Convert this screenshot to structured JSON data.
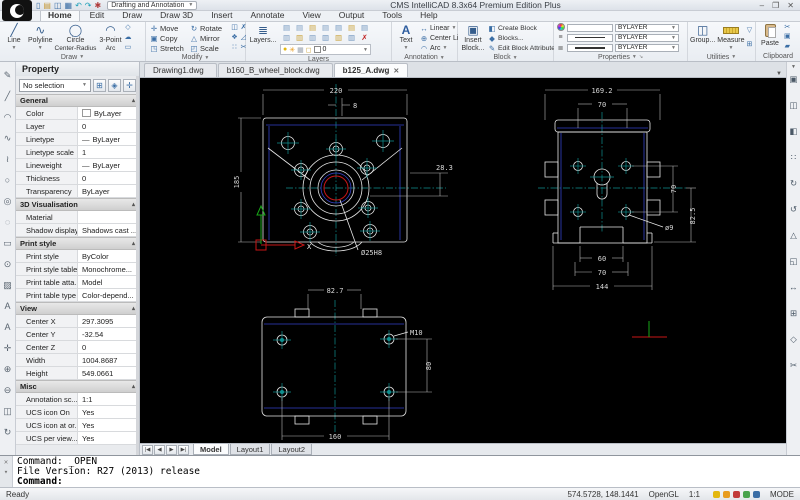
{
  "window": {
    "title": "CMS IntelliCAD 8.3x64 Premium Edition Plus",
    "workspace": "Drafting and Annotation",
    "controls": {
      "minimize": "–",
      "maximize": "❐",
      "close": "✕"
    }
  },
  "quick_access": [
    {
      "name": "new-file-icon",
      "glyph": "▯"
    },
    {
      "name": "open-icon",
      "glyph": "▤"
    },
    {
      "name": "save-icon",
      "glyph": "◫"
    },
    {
      "name": "print-icon",
      "glyph": "▦"
    },
    {
      "name": "undo-icon",
      "glyph": "↶"
    },
    {
      "name": "redo-icon",
      "glyph": "↷"
    },
    {
      "name": "workspace-switch-icon",
      "glyph": "✱"
    }
  ],
  "menu": [
    {
      "label": "Home",
      "active": true
    },
    {
      "label": "Edit"
    },
    {
      "label": "Draw"
    },
    {
      "label": "Draw 3D"
    },
    {
      "label": "Insert"
    },
    {
      "label": "Annotate"
    },
    {
      "label": "View"
    },
    {
      "label": "Output"
    },
    {
      "label": "Tools"
    },
    {
      "label": "Help"
    }
  ],
  "ribbon": {
    "draw": {
      "label": "Draw",
      "buttons": [
        {
          "label": "Line",
          "sub": "",
          "glyph": "╱"
        },
        {
          "label": "Polyline",
          "sub": "",
          "glyph": "∿"
        },
        {
          "label": "Circle",
          "sub": "Center-Radius",
          "glyph": "◯"
        },
        {
          "label": "3-Point",
          "sub": "Arc",
          "glyph": "◠"
        }
      ],
      "mini": [
        {
          "name": "polygon-icon",
          "glyph": "◇"
        },
        {
          "name": "revision-cloud-icon",
          "glyph": "☁"
        },
        {
          "name": "rectangle-icon",
          "glyph": "▭"
        }
      ]
    },
    "modify": {
      "label": "Modify",
      "buttons": [
        {
          "label": "Move",
          "glyph": "✛"
        },
        {
          "label": "Rotate",
          "glyph": "↻"
        },
        {
          "label": "Copy",
          "glyph": "▣"
        },
        {
          "label": "Mirror",
          "glyph": "△"
        },
        {
          "label": "Stretch",
          "glyph": "◳"
        },
        {
          "label": "Scale",
          "glyph": "◰"
        }
      ],
      "mini": [
        {
          "name": "offset-icon",
          "glyph": "◫"
        },
        {
          "name": "erase-icon",
          "glyph": "✗"
        },
        {
          "name": "explode-icon",
          "glyph": "❖"
        },
        {
          "name": "fillet-icon",
          "glyph": "◿"
        },
        {
          "name": "array-icon",
          "glyph": "∷"
        },
        {
          "name": "trim-icon",
          "glyph": "✂"
        }
      ]
    },
    "layers": {
      "label": "Layers",
      "layers_button": "Layers...",
      "current_layer": "0",
      "grid": [
        {
          "name": "layer-on-icon",
          "glyph": "▤"
        },
        {
          "name": "layer-off-icon",
          "glyph": "▤"
        },
        {
          "name": "layer-freeze-icon",
          "glyph": "▤"
        },
        {
          "name": "layer-thaw-icon",
          "glyph": "▤"
        },
        {
          "name": "layer-lock-icon",
          "glyph": "▤"
        },
        {
          "name": "layer-unlock-icon",
          "glyph": "▤"
        },
        {
          "name": "layer-state-icon",
          "glyph": "▤"
        },
        {
          "name": "layer-isolate-icon",
          "glyph": "▥"
        },
        {
          "name": "layer-unisolate-icon",
          "glyph": "▥"
        },
        {
          "name": "layer-match-icon",
          "glyph": "▥"
        },
        {
          "name": "layer-prev-icon",
          "glyph": "▥"
        },
        {
          "name": "layer-walk-icon",
          "glyph": "▥"
        },
        {
          "name": "layer-merge-icon",
          "glyph": "▥"
        },
        {
          "name": "layer-delete-icon",
          "glyph": "✗",
          "red": true
        }
      ]
    },
    "annotation": {
      "label": "Annotation",
      "text_button": "Text",
      "items": [
        {
          "label": "Linear",
          "glyph": "↔"
        },
        {
          "label": "Center Lines",
          "glyph": "⊕"
        },
        {
          "label": "Arc",
          "glyph": "◠"
        }
      ]
    },
    "block": {
      "label": "Block",
      "insert_button": "Insert Block...",
      "items": [
        {
          "label": "Create Block",
          "glyph": "◧"
        },
        {
          "label": "Blocks...",
          "glyph": "◆"
        },
        {
          "label": "Edit Block Attributes",
          "glyph": "✎"
        }
      ]
    },
    "properties": {
      "label": "Properties",
      "rows": [
        {
          "value": "BYLAYER"
        },
        {
          "value": "BYLAYER"
        },
        {
          "value": "BYLAYER"
        }
      ]
    },
    "utilities": {
      "label": "Utilities",
      "group_button": "Group...",
      "measure_button": "Measure",
      "mini": [
        {
          "name": "quick-select-icon",
          "glyph": "▽"
        },
        {
          "name": "id-point-icon",
          "glyph": "⊞"
        }
      ]
    },
    "clipboard": {
      "label": "Clipboard",
      "paste_button": "Paste",
      "mini": [
        {
          "name": "cut-icon",
          "glyph": "✂"
        },
        {
          "name": "copy-clip-icon",
          "glyph": "▣"
        },
        {
          "name": "match-properties-icon",
          "glyph": "▰"
        }
      ]
    }
  },
  "document_tabs": [
    {
      "label": "Drawing1.dwg"
    },
    {
      "label": "b160_B_wheel_block.dwg"
    },
    {
      "label": "b125_A.dwg",
      "active": true,
      "close": "✕"
    }
  ],
  "left_toolbar": [
    {
      "name": "sketch-icon",
      "glyph": "✎"
    },
    {
      "name": "line-icon",
      "glyph": "╱"
    },
    {
      "name": "arc-icon",
      "glyph": "◠"
    },
    {
      "name": "spline-icon",
      "glyph": "∿"
    },
    {
      "name": "freehand-icon",
      "glyph": "≀"
    },
    {
      "name": "circle-icon",
      "glyph": "○"
    },
    {
      "name": "donut-icon",
      "glyph": "◎"
    },
    {
      "name": "ellipse-icon",
      "glyph": "◌"
    },
    {
      "name": "rectangle-icon",
      "glyph": "▭"
    },
    {
      "name": "point-icon",
      "glyph": "⊙"
    },
    {
      "name": "hatch-icon",
      "glyph": "▨"
    },
    {
      "name": "text-icon",
      "glyph": "A"
    },
    {
      "name": "mtext-icon",
      "glyph": "A"
    },
    {
      "name": "pan-icon",
      "glyph": "✛"
    },
    {
      "name": "zoom-in-icon",
      "glyph": "⊕"
    },
    {
      "name": "zoom-out-icon",
      "glyph": "⊖"
    },
    {
      "name": "zoom-window-icon",
      "glyph": "◫"
    },
    {
      "name": "regen-icon",
      "glyph": "↻"
    }
  ],
  "right_toolbar": [
    {
      "name": "copy-entity-icon",
      "glyph": "▣"
    },
    {
      "name": "group-icon",
      "glyph": "◫"
    },
    {
      "name": "lock-icon",
      "glyph": "◧"
    },
    {
      "name": "array-icon",
      "glyph": "∷"
    },
    {
      "name": "rotate-icon",
      "glyph": "↻"
    },
    {
      "name": "rotate-ccw-icon",
      "glyph": "↺"
    },
    {
      "name": "mirror-icon",
      "glyph": "△"
    },
    {
      "name": "scale-icon",
      "glyph": "◱"
    },
    {
      "name": "stretch-icon",
      "glyph": "↔"
    },
    {
      "name": "align-icon",
      "glyph": "⊞"
    },
    {
      "name": "explode-icon",
      "glyph": "◇"
    },
    {
      "name": "trim-icon",
      "glyph": "✂"
    }
  ],
  "property_panel": {
    "title": "Property",
    "selector": "No selection",
    "sections": [
      {
        "title": "General",
        "rows": [
          {
            "label": "Color",
            "value": "ByLayer"
          },
          {
            "label": "Layer",
            "value": "0"
          },
          {
            "label": "Linetype",
            "value": "ByLayer"
          },
          {
            "label": "Linetype scale",
            "value": "1"
          },
          {
            "label": "Lineweight",
            "value": "ByLayer"
          },
          {
            "label": "Thickness",
            "value": "0"
          },
          {
            "label": "Transparency",
            "value": "ByLayer"
          }
        ]
      },
      {
        "title": "3D Visualisation",
        "rows": [
          {
            "label": "Material",
            "value": ""
          },
          {
            "label": "Shadow display",
            "value": "Shadows cast ..."
          }
        ]
      },
      {
        "title": "Print style",
        "rows": [
          {
            "label": "Print style",
            "value": "ByColor"
          },
          {
            "label": "Print style table",
            "value": "Monochrome..."
          },
          {
            "label": "Print table atta...",
            "value": "Model"
          },
          {
            "label": "Print table type",
            "value": "Color-depend..."
          }
        ]
      },
      {
        "title": "View",
        "rows": [
          {
            "label": "Center X",
            "value": "297.3095"
          },
          {
            "label": "Center Y",
            "value": "-32.54"
          },
          {
            "label": "Center Z",
            "value": "0"
          },
          {
            "label": "Width",
            "value": "1004.8687"
          },
          {
            "label": "Height",
            "value": "549.0661"
          }
        ]
      },
      {
        "title": "Misc",
        "rows": [
          {
            "label": "Annotation sc...",
            "value": "1:1"
          },
          {
            "label": "UCS icon On",
            "value": "Yes"
          },
          {
            "label": "UCS icon at or...",
            "value": "Yes"
          },
          {
            "label": "UCS per view...",
            "value": "Yes"
          }
        ]
      }
    ]
  },
  "drawing": {
    "front_view": {
      "dim_width": "220",
      "dim_offset": "8",
      "dim_height": "185",
      "dim_depth": "28.3",
      "bore_label": "Ø25H8",
      "axis_label": "X"
    },
    "side_view": {
      "dim_width": "169.2",
      "dim_hole_h": "70",
      "dim_hole_v": "70",
      "dim_height": "82.5",
      "hole_label": "ø9",
      "dim_slot": "60",
      "dim_slot_outer": "70",
      "dim_base": "144"
    },
    "bottom_view": {
      "dim_top": "82.7",
      "thread_label": "M10",
      "dim_side": "80",
      "dim_width": "160"
    }
  },
  "model_tabs": {
    "nav": [
      {
        "glyph": "|◀"
      },
      {
        "glyph": "◀"
      },
      {
        "glyph": "▶"
      },
      {
        "glyph": "▶|"
      }
    ],
    "tabs": [
      {
        "label": "Model",
        "active": true
      },
      {
        "label": "Layout1"
      },
      {
        "label": "Layout2"
      }
    ]
  },
  "command": {
    "lines": [
      {
        "text": "Command: _OPEN"
      },
      {
        "text": "File Version: R27 (2013) release"
      }
    ],
    "prompt": "Command:"
  },
  "status_bar": {
    "ready": "Ready",
    "coords": "574.5728, 148.1441",
    "renderer": "OpenGL",
    "scale": "1:1",
    "mode": "MODE"
  }
}
